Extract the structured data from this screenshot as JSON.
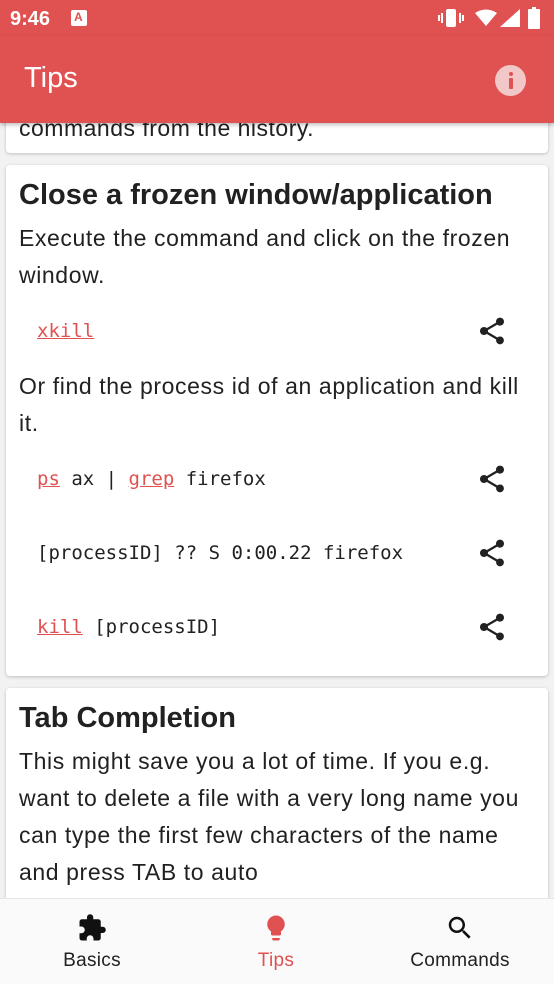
{
  "status_bar": {
    "time": "9:46"
  },
  "app_bar": {
    "title": "Tips"
  },
  "tips": {
    "previous_card_text": "commands from the history.",
    "frozen": {
      "title": "Close a frozen window/application",
      "text1": "Execute the command and click on the frozen window.",
      "cmd1": {
        "kw": "xkill"
      },
      "text2": "Or find the process id of an application and kill it.",
      "cmd2": {
        "kw1": "ps",
        "mid": " ax | ",
        "kw2": "grep",
        "rest": " firefox"
      },
      "cmd3": {
        "text": "[processID] ?? S 0:00.22 firefox"
      },
      "cmd4": {
        "kw": "kill",
        "rest": " [processID]"
      }
    },
    "tab_completion": {
      "title": "Tab Completion",
      "text": "This might save you a lot of time. If you e.g. want to delete a file with a very long name you can type the first few characters of the name and press TAB to auto"
    }
  },
  "bottom_nav": {
    "items": [
      {
        "label": "Basics",
        "icon": "puzzle-icon"
      },
      {
        "label": "Tips",
        "icon": "lightbulb-icon"
      },
      {
        "label": "Commands",
        "icon": "search-icon"
      }
    ],
    "active": "Tips"
  },
  "colors": {
    "primary": "#e05151",
    "surface": "#ffffff",
    "background": "#f2f2f2",
    "text": "#212121"
  }
}
